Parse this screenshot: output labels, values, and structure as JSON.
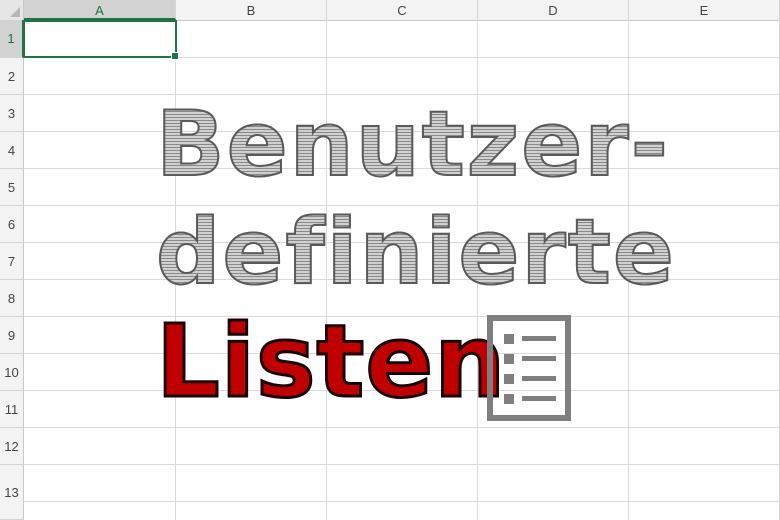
{
  "columns": [
    "A",
    "B",
    "C",
    "D",
    "E"
  ],
  "rows": [
    "1",
    "2",
    "3",
    "4",
    "5",
    "6",
    "7",
    "8",
    "9",
    "10",
    "11",
    "12",
    "13"
  ],
  "active_cell": "A1",
  "title": {
    "line1": "Benutzer-",
    "line2": "definierte",
    "line3": "Listen"
  },
  "colors": {
    "accent": "#217346",
    "title_grey": "#8a8a8a",
    "title_red": "#c00000",
    "icon_grey": "#7f7f7f"
  },
  "icons": {
    "list": "list-icon"
  }
}
